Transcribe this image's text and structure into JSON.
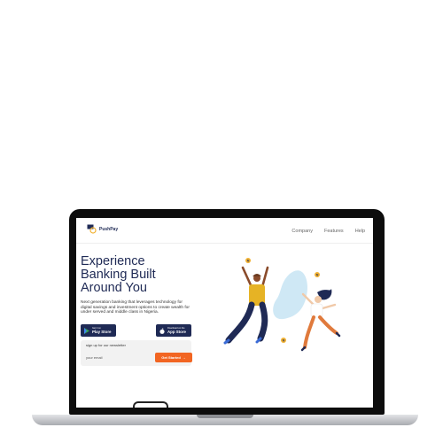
{
  "brand": {
    "name": "PushPay"
  },
  "nav": {
    "links": [
      "Company",
      "Features",
      "Help"
    ]
  },
  "hero": {
    "title_lines": [
      "Experience",
      "Banking Built",
      "Around You"
    ],
    "subtitle": "Next generation banking that leverages technology for digital savings and investment options to create wealth for under served and middle class in Nigeria."
  },
  "stores": {
    "google": {
      "small": "Get it on",
      "big": "Play Store"
    },
    "apple": {
      "small": "Download on the",
      "big": "App Store"
    }
  },
  "newsletter": {
    "label": "sign up for our newsletter",
    "placeholder": "your email",
    "button": "Get Started",
    "button_arrow": "→"
  },
  "coins": {
    "symbol": "₦"
  },
  "colors": {
    "brand_navy": "#1f2a55",
    "accent_orange": "#f26522",
    "coin_yellow": "#f2b233",
    "blob_blue": "#cfe8f5"
  }
}
